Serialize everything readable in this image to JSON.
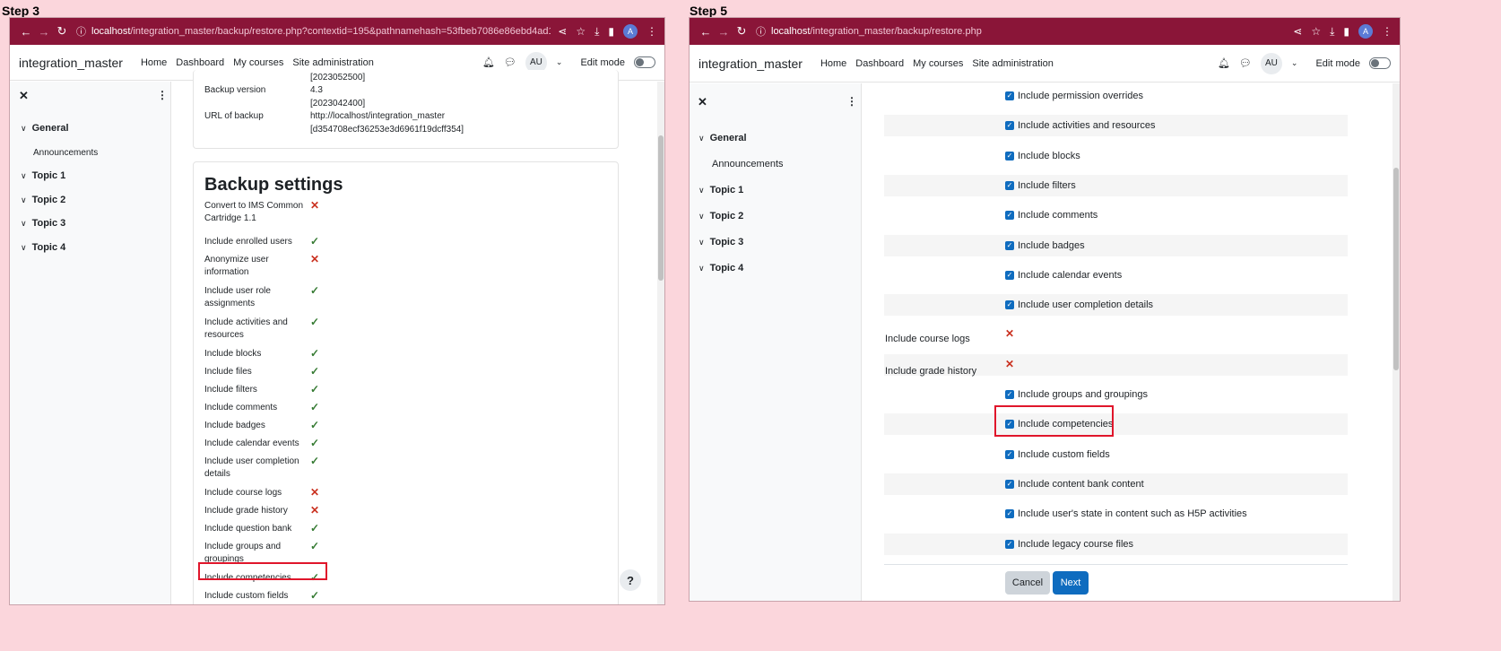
{
  "left": {
    "step_label": "Step 3",
    "url_host": "localhost",
    "url_path": "/integration_master/backup/restore.php?contextid=195&pathnamehash=53fbeb7086e86ebd4ad1ef98c21688f37c5...",
    "brand": "integration_master",
    "nav": [
      "Home",
      "Dashboard",
      "My courses",
      "Site administration"
    ],
    "avatar": "AU",
    "edit_mode": "Edit mode",
    "drawer": {
      "close": "✕",
      "kebab": "⋮",
      "sections": [
        "General",
        "Topic 1",
        "Topic 2",
        "Topic 3",
        "Topic 4"
      ],
      "sub": "Announcements"
    },
    "info": {
      "top_value": "[2023052500]",
      "backup_version_label": "Backup version",
      "backup_version_value1": "4.3",
      "backup_version_value2": "[2023042400]",
      "url_label": "URL of backup",
      "url_value1": "http://localhost/integration_master",
      "url_value2": "[d354708ecf36253e3d6961f19dcff354]"
    },
    "backup_settings_title": "Backup settings",
    "settings": [
      {
        "label": "Convert to IMS Common Cartridge 1.1",
        "ok": false
      },
      {
        "label": "Include enrolled users",
        "ok": true
      },
      {
        "label": "Anonymize user information",
        "ok": false
      },
      {
        "label": "Include user role assignments",
        "ok": true
      },
      {
        "label": "Include activities and resources",
        "ok": true
      },
      {
        "label": "Include blocks",
        "ok": true
      },
      {
        "label": "Include files",
        "ok": true
      },
      {
        "label": "Include filters",
        "ok": true
      },
      {
        "label": "Include comments",
        "ok": true
      },
      {
        "label": "Include badges",
        "ok": true
      },
      {
        "label": "Include calendar events",
        "ok": true
      },
      {
        "label": "Include user completion details",
        "ok": true
      },
      {
        "label": "Include course logs",
        "ok": false
      },
      {
        "label": "Include grade history",
        "ok": false
      },
      {
        "label": "Include question bank",
        "ok": true
      },
      {
        "label": "Include groups and groupings",
        "ok": true
      },
      {
        "label": "Include competencies",
        "ok": true
      },
      {
        "label": "Include custom fields",
        "ok": true
      }
    ],
    "help": "?"
  },
  "right": {
    "step_label": "Step 5",
    "url_host": "localhost",
    "url_path": "/integration_master/backup/restore.php",
    "brand": "integration_master",
    "nav": [
      "Home",
      "Dashboard",
      "My courses",
      "Site administration"
    ],
    "avatar": "AU",
    "edit_mode": "Edit mode",
    "drawer": {
      "close": "✕",
      "kebab": "⋮",
      "sections": [
        "General",
        "Topic 1",
        "Topic 2",
        "Topic 3",
        "Topic 4"
      ],
      "sub": "Announcements"
    },
    "rows": [
      {
        "label": "Include permission overrides",
        "kind": "check"
      },
      {
        "label": "Include activities and resources",
        "kind": "check"
      },
      {
        "label": "Include blocks",
        "kind": "check"
      },
      {
        "label": "Include filters",
        "kind": "check"
      },
      {
        "label": "Include comments",
        "kind": "check"
      },
      {
        "label": "Include badges",
        "kind": "check"
      },
      {
        "label": "Include calendar events",
        "kind": "check"
      },
      {
        "label": "Include user completion details",
        "kind": "check"
      },
      {
        "label": "Include course logs",
        "kind": "x"
      },
      {
        "label": "Include grade history",
        "kind": "x"
      },
      {
        "label": "Include groups and groupings",
        "kind": "check"
      },
      {
        "label": "Include competencies",
        "kind": "check"
      },
      {
        "label": "Include custom fields",
        "kind": "check"
      },
      {
        "label": "Include content bank content",
        "kind": "check"
      },
      {
        "label": "Include user's state in content such as H5P activities",
        "kind": "check"
      },
      {
        "label": "Include legacy course files",
        "kind": "check"
      }
    ],
    "cancel": "Cancel",
    "next": "Next"
  }
}
